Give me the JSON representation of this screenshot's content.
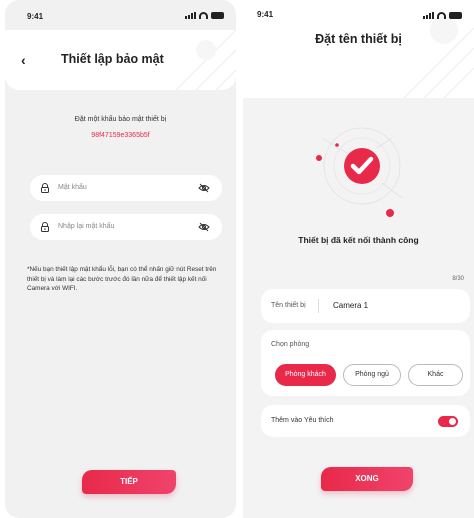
{
  "screen1": {
    "status_time": "9:41",
    "title": "Thiết lập bảo mật",
    "password_label": "Đặt một khẩu bảo mật thiết bị",
    "device_code": "98f47159e3365b5f",
    "password_placeholder": "Mật khẩu",
    "confirm_placeholder": "Nhập lại mật khẩu",
    "note": "*Nếu bạn thiết lập mật khẩu lỗi, bạn có thể nhấn giữ nút Reset trên thiết bị và làm lại các bước trước đó lần nữa để thiết lập kết nối Camera với WIFI.",
    "next_label": "TIẾP"
  },
  "screen2": {
    "status_time": "9:41",
    "title": "Đặt tên thiết bị",
    "success_text": "Thiết bị đã kết nối thành công",
    "char_count": "8/30",
    "name_label": "Tên thiết bị",
    "name_value": "Camera 1",
    "room_label": "Chọn phòng",
    "rooms": [
      "Phòng khách",
      "Phòng ngủ",
      "Khác"
    ],
    "selected_room": "Phòng khách",
    "favorite_label": "Thêm vào Yêu thích",
    "favorite_on": true,
    "done_label": "XONG"
  },
  "colors": {
    "accent": "#e8294a",
    "background": "#f1f1f1",
    "card": "#ffffff"
  },
  "icons": [
    "back-arrow-icon",
    "signal-icon",
    "wifi-icon",
    "battery-icon",
    "lock-icon",
    "eye-off-icon",
    "checkmark-icon",
    "toggle-icon"
  ]
}
